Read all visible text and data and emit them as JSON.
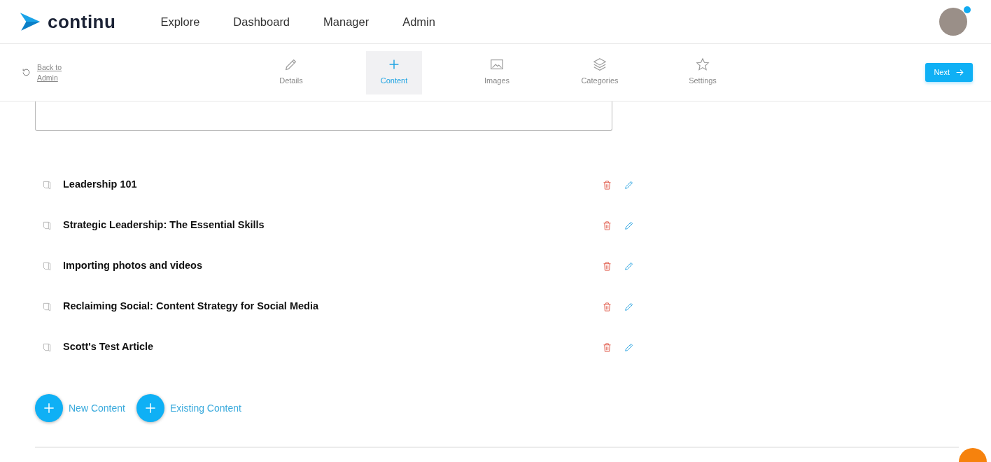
{
  "header": {
    "logo": "continu",
    "nav": [
      {
        "label": "Explore"
      },
      {
        "label": "Dashboard"
      },
      {
        "label": "Manager"
      },
      {
        "label": "Admin"
      }
    ],
    "avatar": {
      "notification": true
    }
  },
  "toolbar": {
    "back": "Back to Admin",
    "steps": [
      {
        "label": "Details",
        "selected": false
      },
      {
        "label": "Content",
        "selected": true
      },
      {
        "label": "Images",
        "selected": false
      },
      {
        "label": "Categories",
        "selected": false
      },
      {
        "label": "Settings",
        "selected": false
      }
    ],
    "next": "Next"
  },
  "content_items": [
    {
      "title": "Leadership 101"
    },
    {
      "title": "Strategic Leadership: The Essential Skills"
    },
    {
      "title": "Importing photos and videos"
    },
    {
      "title": "Reclaiming Social: Content Strategy for Social Media"
    },
    {
      "title": "Scott's Test Article"
    }
  ],
  "actions": [
    {
      "label": "New Content"
    },
    {
      "label": "Existing Content"
    }
  ]
}
